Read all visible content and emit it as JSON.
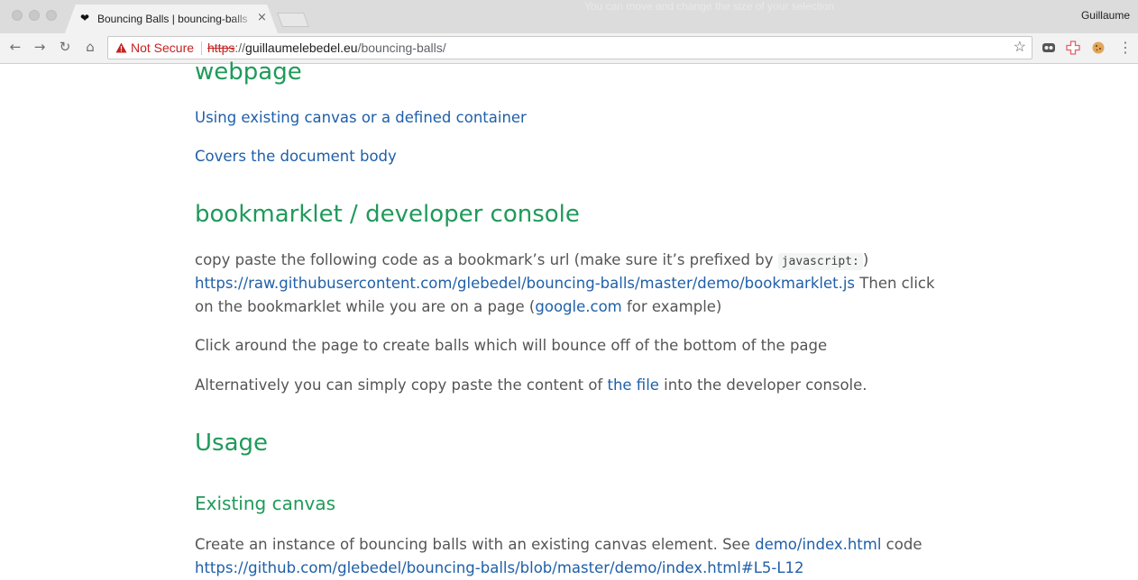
{
  "browser": {
    "tab": {
      "favicon": "heart-icon",
      "title": "Bouncing Balls | bouncing-balls",
      "close_label": "×"
    },
    "selection_hint": "You can move and change the size of your selection",
    "profile_name": "Guillaume",
    "nav": {
      "back": "←",
      "forward": "→",
      "reload": "↻",
      "home": "⌂",
      "menu": "⋮"
    },
    "omnibox": {
      "security_label": "Not Secure",
      "url_scheme": "https",
      "url_sep": "://",
      "url_host": "guillaumelebedel.eu",
      "url_path": "/bouncing-balls/"
    },
    "extensions": [
      "ghost-mask-icon",
      "medical-cross-icon",
      "cookie-icon"
    ],
    "colors": {
      "insecure": "#c5221f",
      "heading": "#1f9a5a",
      "link": "#1f5fa8"
    }
  },
  "page": {
    "heading_webpage": "webpage",
    "link_existing_canvas": "Using existing canvas or a defined container",
    "link_covers_body": "Covers the document body",
    "heading_bookmarklet": "bookmarklet / developer console",
    "bm_p1_a": "copy paste the following code as a bookmark’s url (make sure it’s prefixed by ",
    "bm_p1_code": "javascript:",
    "bm_p1_b": ")",
    "bm_link": "https://raw.githubusercontent.com/glebedel/bouncing-balls/master/demo/bookmarklet.js",
    "bm_p2_a": " Then click",
    "bm_p3_a": "on the bookmarklet while you are on a page (",
    "bm_p3_link": "google.com",
    "bm_p3_b": " for example)",
    "bm_click": "Click around the page to create balls which will bounce off of the bottom of the page",
    "bm_alt_a": "Alternatively you can simply copy paste the content of ",
    "bm_alt_link": "the file",
    "bm_alt_b": " into the developer console.",
    "heading_usage": "Usage",
    "heading_existing_canvas": "Existing canvas",
    "usage_p_a": "Create an instance of bouncing balls with an existing canvas element. See ",
    "usage_p_link": "demo/index.html",
    "usage_p_b": " code",
    "usage_link2": "https://github.com/glebedel/bouncing-balls/blob/master/demo/index.html#L5-L12"
  }
}
